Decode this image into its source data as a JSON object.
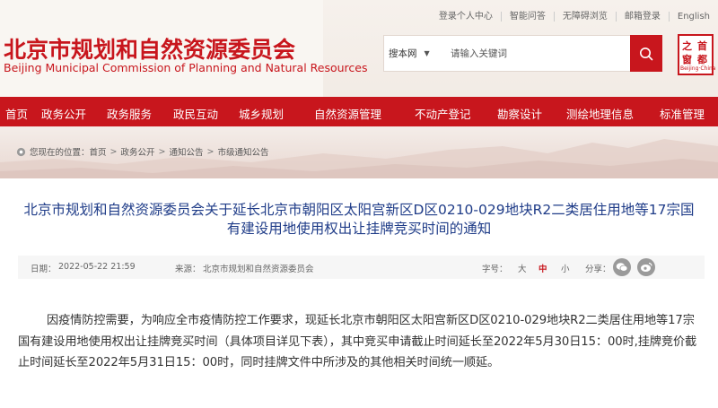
{
  "top_links": [
    "登录个人中心",
    "智能问答",
    "无障碍浏览",
    "邮箱登录",
    "English"
  ],
  "site": {
    "title_cn": "北京市规划和自然资源委员会",
    "title_en": "Beijing Municipal Commission of Planning and Natural Resources"
  },
  "search": {
    "scope": "搜本网",
    "placeholder": "请输入关键词"
  },
  "seal": {
    "chars": [
      "首",
      "都",
      "之",
      "窗"
    ],
    "caption": "Beijing·China"
  },
  "nav": [
    "首页",
    "政务公开",
    "政务服务",
    "政民互动",
    "城乡规划",
    "自然资源管理",
    "不动产登记",
    "勘察设计",
    "测绘地理信息",
    "标准管理"
  ],
  "breadcrumb": {
    "prefix": "您现在的位置：",
    "items": [
      "首页",
      "政务公开",
      "通知公告",
      "市级通知公告"
    ]
  },
  "article": {
    "title": "北京市规划和自然资源委员会关于延长北京市朝阳区太阳宫新区D区0210-029地块R2二类居住用地等17宗国有建设用地使用权出让挂牌竞买时间的通知",
    "date_label": "日期：",
    "date": "2022-05-22 21:59",
    "source_label": "来源：",
    "source": "北京市规划和自然资源委员会",
    "fontsize_label": "字号：",
    "fontsizes": [
      "大",
      "中",
      "小"
    ],
    "share_label": "分享：",
    "body": "因疫情防控需要，为响应全市疫情防控工作要求，现延长北京市朝阳区太阳宫新区D区0210-029地块R2二类居住用地等17宗国有建设用地使用权出让挂牌竞买时间（具体项目详见下表），其中竞买申请截止时间延长至2022年5月30日15：00时,挂牌竞价截止时间延长至2022年5月31日15：00时，同时挂牌文件中所涉及的其他相关时间统一顺延。"
  },
  "colors": {
    "brand_red": "#c8161d",
    "title_blue": "#1f3c88"
  }
}
